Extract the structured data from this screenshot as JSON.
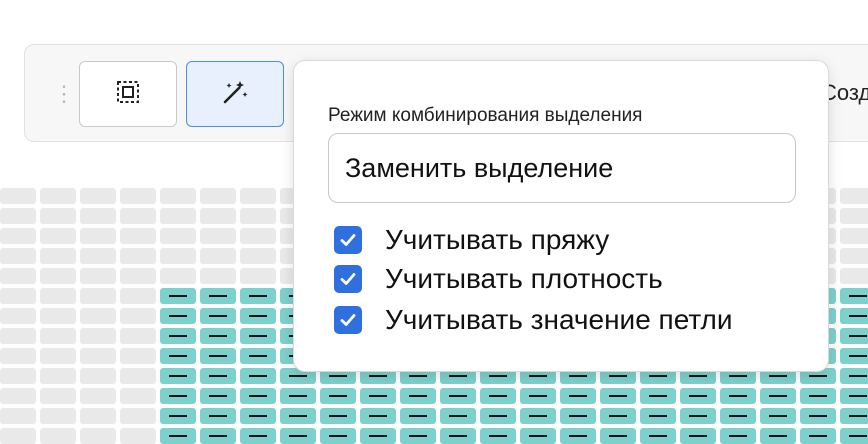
{
  "toolbar": {
    "drag_handle": "⋮",
    "create_label": "Созд"
  },
  "popover": {
    "mode_label": "Режим комбинирования выделения",
    "mode_value": "Заменить выделение",
    "options": [
      {
        "label": "Учитывать пряжу",
        "checked": true
      },
      {
        "label": "Учитывать плотность",
        "checked": true
      },
      {
        "label": "Учитывать значение петли",
        "checked": true
      }
    ]
  },
  "icons": {
    "select_box": "select-box-icon",
    "magic_wand": "magic-wand-icon",
    "checkmark": "checkmark-icon"
  },
  "colors": {
    "accent": "#2f6fde",
    "selected_cell": "#7dd1cc",
    "empty_cell": "#e9e9e9",
    "active_button_border": "#4d8fe0"
  }
}
